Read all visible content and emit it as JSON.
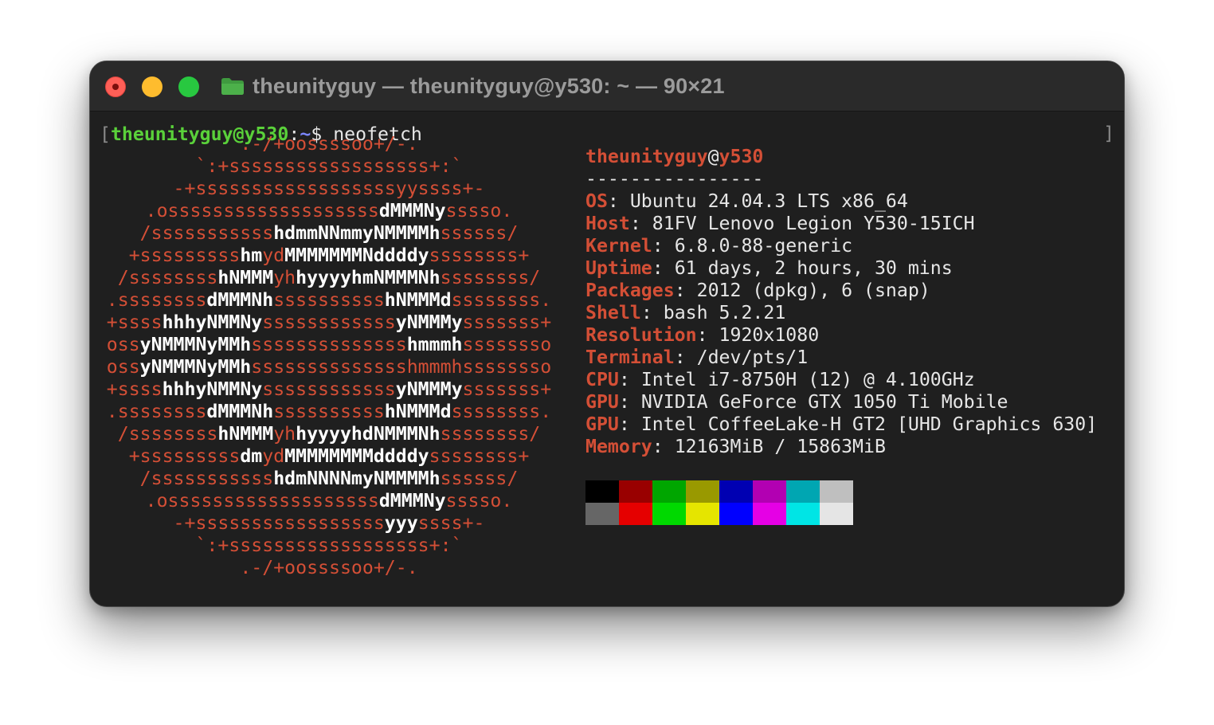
{
  "window": {
    "title": "theunityguy — theunityguy@y530: ~ — 90×21",
    "traffic_lights": [
      "close-button",
      "minimize-button",
      "zoom-button"
    ]
  },
  "prompt": {
    "open_bracket": "[",
    "user_host": "theunityguy@y530",
    "colon": ":",
    "path": "~",
    "symbol": "$ ",
    "command": "neofetch",
    "close_bracket": "]"
  },
  "logo_lines": [
    [
      [
        "r",
        ".-/+oossssoo+/-."
      ]
    ],
    [
      [
        "r",
        "`:+ssssssssssssssssss+:`"
      ]
    ],
    [
      [
        "r",
        "-+ssssssssssssssssssyyssss+-"
      ]
    ],
    [
      [
        "r",
        ".osssssssssssssssssss"
      ],
      [
        "w",
        "dMMMNy"
      ],
      [
        "r",
        "sssso."
      ]
    ],
    [
      [
        "r",
        "/sssssssssss"
      ],
      [
        "w",
        "hdmmNNmmyNMMMMh"
      ],
      [
        "r",
        "ssssss/"
      ]
    ],
    [
      [
        "r",
        "+sssssssss"
      ],
      [
        "w",
        "hm"
      ],
      [
        "r",
        "yd"
      ],
      [
        "w",
        "MMMMMMMNddddy"
      ],
      [
        "r",
        "ssssssss+"
      ]
    ],
    [
      [
        "r",
        "/ssssssss"
      ],
      [
        "w",
        "hNMMM"
      ],
      [
        "r",
        "yh"
      ],
      [
        "w",
        "hyyyyhmNMMMNh"
      ],
      [
        "r",
        "ssssssss/"
      ]
    ],
    [
      [
        "r",
        ".ssssssss"
      ],
      [
        "w",
        "dMMMNh"
      ],
      [
        "r",
        "ssssssssss"
      ],
      [
        "w",
        "hNMMMd"
      ],
      [
        "r",
        "ssssssss."
      ]
    ],
    [
      [
        "r",
        "+ssss"
      ],
      [
        "w",
        "hhhyNMMNy"
      ],
      [
        "r",
        "ssssssssssss"
      ],
      [
        "w",
        "yNMMMy"
      ],
      [
        "r",
        "sssssss+"
      ]
    ],
    [
      [
        "r",
        "oss"
      ],
      [
        "w",
        "yNMMMNyMMh"
      ],
      [
        "r",
        "ssssssssssssss"
      ],
      [
        "w",
        "hmmmh"
      ],
      [
        "r",
        "ssssssso"
      ]
    ],
    [
      [
        "r",
        "oss"
      ],
      [
        "w",
        "yNMMMNyMMh"
      ],
      [
        "r",
        "sssssssssssssshmmmhssssssso"
      ]
    ],
    [
      [
        "r",
        "+ssss"
      ],
      [
        "w",
        "hhhyNMMNy"
      ],
      [
        "r",
        "ssssssssssss"
      ],
      [
        "w",
        "yNMMMy"
      ],
      [
        "r",
        "sssssss+"
      ]
    ],
    [
      [
        "r",
        ".ssssssss"
      ],
      [
        "w",
        "dMMMNh"
      ],
      [
        "r",
        "ssssssssss"
      ],
      [
        "w",
        "hNMMMd"
      ],
      [
        "r",
        "ssssssss."
      ]
    ],
    [
      [
        "r",
        "/ssssssss"
      ],
      [
        "w",
        "hNMMM"
      ],
      [
        "r",
        "yh"
      ],
      [
        "w",
        "hyyyyhdNMMMNh"
      ],
      [
        "r",
        "ssssssss/"
      ]
    ],
    [
      [
        "r",
        "+sssssssss"
      ],
      [
        "w",
        "dm"
      ],
      [
        "r",
        "yd"
      ],
      [
        "w",
        "MMMMMMMMddddy"
      ],
      [
        "r",
        "ssssssss+"
      ]
    ],
    [
      [
        "r",
        "/sssssssssss"
      ],
      [
        "w",
        "hdmNNNNmyNMMMMh"
      ],
      [
        "r",
        "ssssss/"
      ]
    ],
    [
      [
        "r",
        ".osssssssssssssssssss"
      ],
      [
        "w",
        "dMMMNy"
      ],
      [
        "r",
        "sssso."
      ]
    ],
    [
      [
        "r",
        "-+sssssssssssssssss"
      ],
      [
        "w",
        "yyy"
      ],
      [
        "r",
        "ssss+-"
      ]
    ],
    [
      [
        "r",
        "`:+ssssssssssssssssss+:`"
      ]
    ],
    [
      [
        "r",
        ".-/+oossssoo+/-."
      ]
    ]
  ],
  "info": {
    "user": "theunityguy",
    "at": "@",
    "host": "y530",
    "separator": "----------------",
    "rows": [
      {
        "key": "OS",
        "value": "Ubuntu 24.04.3 LTS x86_64"
      },
      {
        "key": "Host",
        "value": "81FV Lenovo Legion Y530-15ICH"
      },
      {
        "key": "Kernel",
        "value": "6.8.0-88-generic"
      },
      {
        "key": "Uptime",
        "value": "61 days, 2 hours, 30 mins"
      },
      {
        "key": "Packages",
        "value": "2012 (dpkg), 6 (snap)"
      },
      {
        "key": "Shell",
        "value": "bash 5.2.21"
      },
      {
        "key": "Resolution",
        "value": "1920x1080"
      },
      {
        "key": "Terminal",
        "value": "/dev/pts/1"
      },
      {
        "key": "CPU",
        "value": "Intel i7-8750H (12) @ 4.100GHz"
      },
      {
        "key": "GPU",
        "value": "NVIDIA GeForce GTX 1050 Ti Mobile"
      },
      {
        "key": "GPU",
        "value": "Intel CoffeeLake-H GT2 [UHD Graphics 630]"
      },
      {
        "key": "Memory",
        "value": "12163MiB / 15863MiB"
      }
    ]
  },
  "palette": {
    "row1": [
      "#000000",
      "#990000",
      "#00a600",
      "#999900",
      "#0000b2",
      "#b200b2",
      "#00a6b2",
      "#bfbfbf"
    ],
    "row2": [
      "#666666",
      "#e50000",
      "#00d900",
      "#e5e500",
      "#0000ff",
      "#e500e5",
      "#00e5e5",
      "#e5e5e5"
    ]
  }
}
